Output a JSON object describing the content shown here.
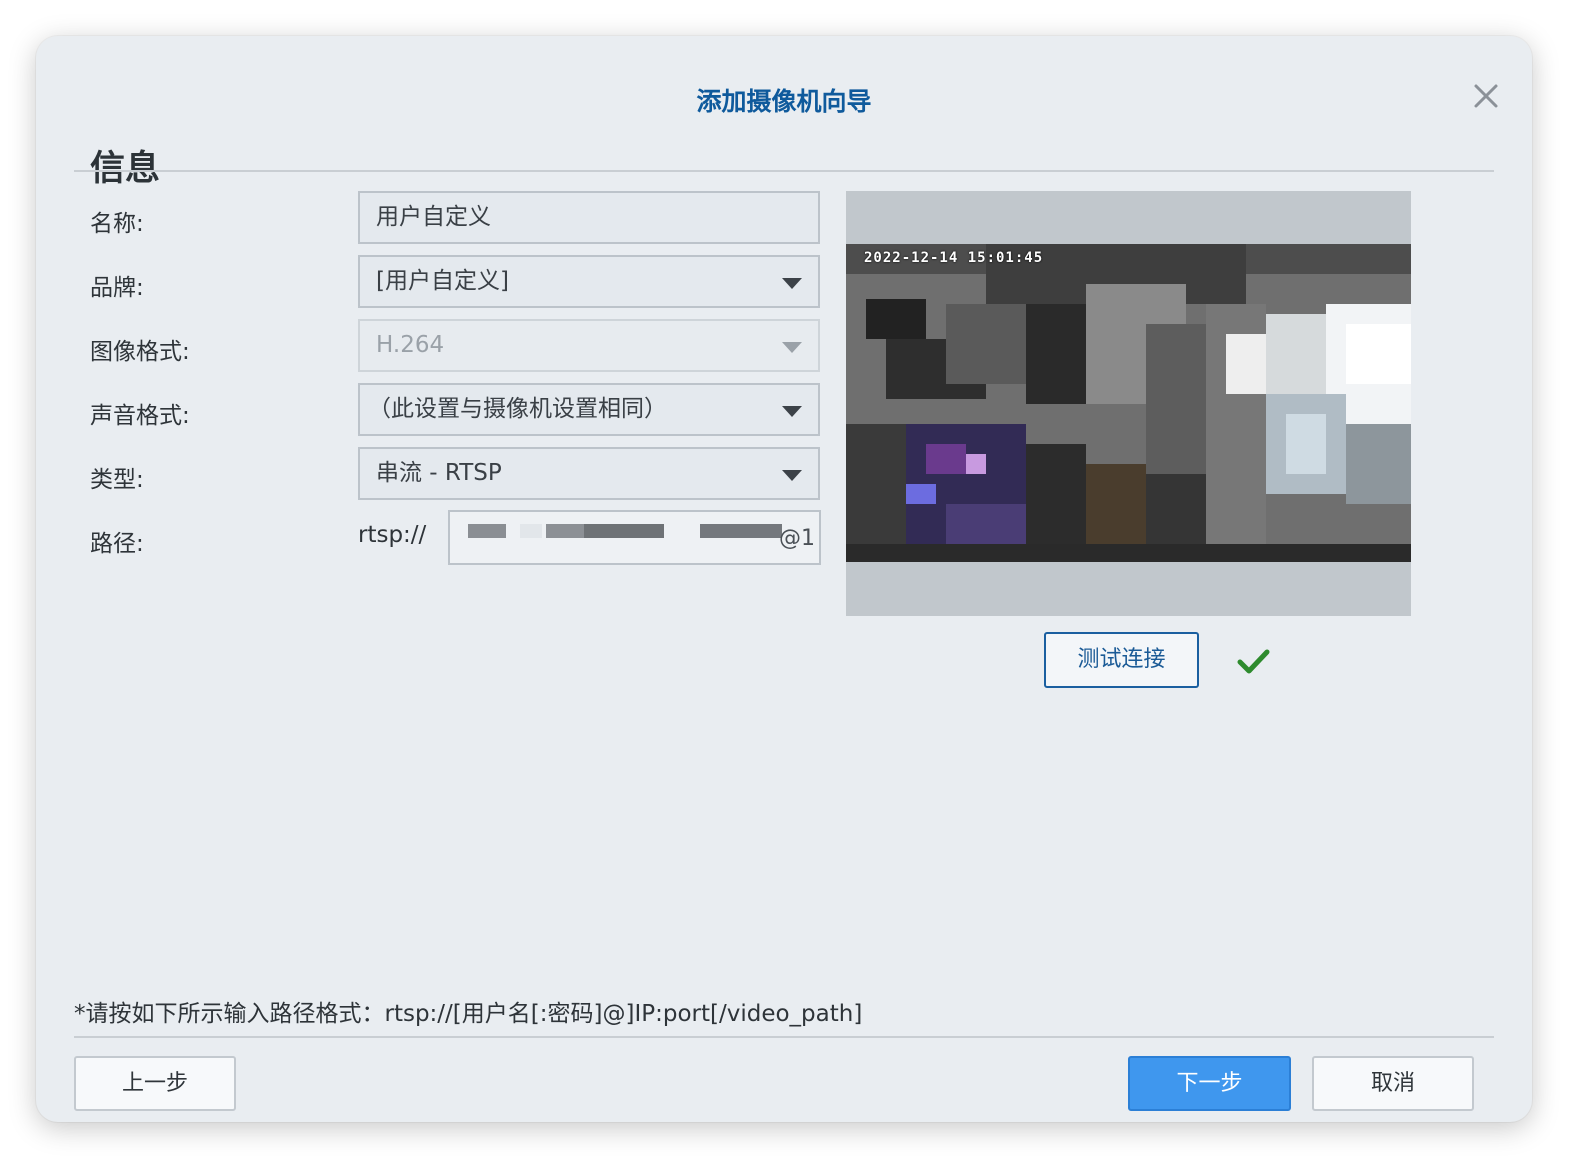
{
  "dialog": {
    "title": "添加摄像机向导",
    "close_icon": "close-icon",
    "section_title": "信息"
  },
  "form": {
    "name": {
      "label": "名称:",
      "value": "用户自定义"
    },
    "brand": {
      "label": "品牌:",
      "value": "[用户自定义]"
    },
    "image_format": {
      "label": "图像格式:",
      "value": "H.264"
    },
    "audio_format": {
      "label": "声音格式:",
      "value": "（此设置与摄像机设置相同）"
    },
    "type": {
      "label": "类型:",
      "value": "串流 - RTSP"
    },
    "path": {
      "label": "路径:",
      "prefix": "rtsp://",
      "suffix": "@1"
    }
  },
  "preview": {
    "timestamp": "2022-12-14 15:01:45",
    "test_button": "测试连接",
    "status_icon": "check-icon",
    "status_color": "#2e8b2e"
  },
  "hint": "*请按如下所示输入路径格式：rtsp://[用户名[:密码]@]IP:port[/video_path]",
  "footer": {
    "back_label": "上一步",
    "next_label": "下一步",
    "cancel_label": "取消"
  },
  "colors": {
    "title": "#0f5a9c",
    "primary": "#3f97ee",
    "dialog_bg": "#e9edf1"
  }
}
